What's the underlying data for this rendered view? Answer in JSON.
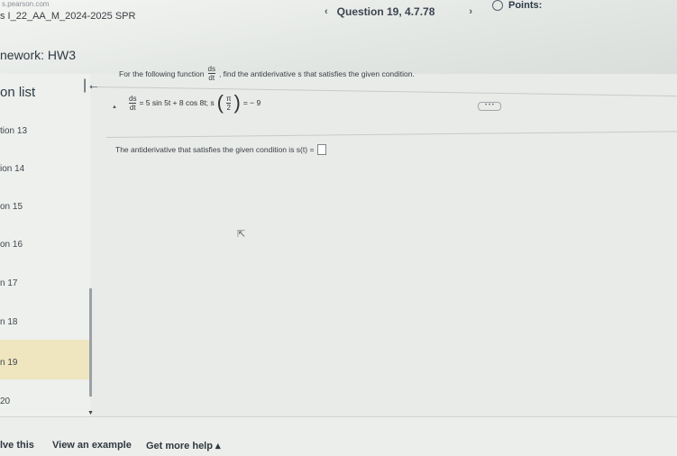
{
  "header": {
    "url": "s.pearson.com",
    "course": "s I_22_AA_M_2024-2025 SPR",
    "homework": "nework:  HW3",
    "question_label": "Question 19, 4.7.78",
    "prev_arrow": "‹",
    "next_arrow": "›",
    "points_label": "Points:"
  },
  "sidebar": {
    "title": "on list",
    "items": [
      {
        "label": "tion 13"
      },
      {
        "label": "ion 14"
      },
      {
        "label": "on 15"
      },
      {
        "label": "on 16"
      },
      {
        "label": "n 17"
      },
      {
        "label": "n 18"
      },
      {
        "label": "n 19",
        "active": true
      },
      {
        "label": "20"
      }
    ]
  },
  "problem": {
    "prompt_before": "For the following function",
    "frac_num": "ds",
    "frac_den": "dt",
    "prompt_after": ", find the antiderivative s that satisfies the given condition.",
    "eq_rhs": "= 5 sin 5t + 8 cos 8t;  s",
    "eq_pi": "π",
    "eq_two": "2",
    "eq_value": "= − 9",
    "more_label": "• • •",
    "answer_prompt": "The antiderivative that satisfies the given condition is s(t) ="
  },
  "footer": {
    "solve": "lve this",
    "example": "View an example",
    "help": "Get more help ▴"
  }
}
